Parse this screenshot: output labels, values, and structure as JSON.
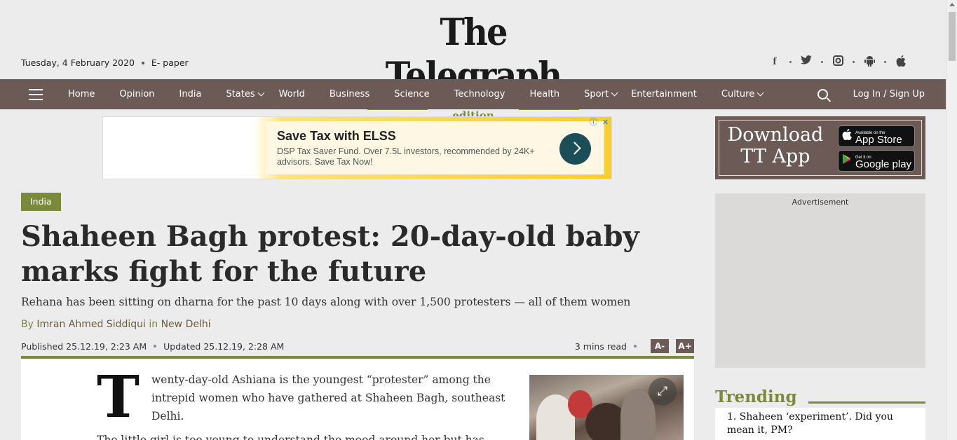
{
  "header": {
    "date": "Tuesday, 4 February 2020",
    "epaper": "E- paper",
    "logo_title": "The Telegraph",
    "logo_edition": "online edition",
    "social": [
      "facebook-icon",
      "twitter-icon",
      "instagram-icon",
      "android-icon",
      "apple-icon"
    ]
  },
  "nav": {
    "items": [
      {
        "label": "Home"
      },
      {
        "label": "Opinion"
      },
      {
        "label": "India"
      },
      {
        "label": "States",
        "dropdown": true
      },
      {
        "label": "World"
      },
      {
        "label": "Business"
      },
      {
        "label": "Science"
      },
      {
        "label": "Technology"
      },
      {
        "label": "Health"
      },
      {
        "label": "Sport",
        "dropdown": true
      },
      {
        "label": "Entertainment"
      },
      {
        "label": "Culture",
        "dropdown": true
      }
    ],
    "login": "Log In / Sign Up"
  },
  "ad": {
    "heading": "Save Tax with ELSS",
    "desc": "DSP Tax Saver Fund. Over 7.5L investors, recommended by 24K+ advisors. Save Tax Now!"
  },
  "sidebar": {
    "app_title_1": "Download",
    "app_title_2": "TT App",
    "appstore_small": "Available on the",
    "appstore_big": "App Store",
    "googleplay_small": "Get it on",
    "googleplay_big": "Google play",
    "ad_label": "Advertisement",
    "trending_title": "Trending",
    "trending_items": [
      "1. Shaheen ‘experiment’. Did you mean it, PM?"
    ]
  },
  "article": {
    "tag": "India",
    "headline": "Shaheen Bagh protest: 20-day-old baby marks fight for the future",
    "subhead": "Rehana has been sitting on dharna for the past 10 days along with over 1,500 protesters — all of them women",
    "by": "By",
    "author": "Imran Ahmed Siddiqui",
    "in": "in",
    "location": "New Delhi",
    "published": "Published 25.12.19, 2:23 AM",
    "updated": "Updated 25.12.19, 2:28 AM",
    "read_time": "3 mins read",
    "font_down": "A-",
    "font_up": "A+",
    "dropcap": "T",
    "para1": "wenty-day-old Ashiana is the youngest “protester” among the intrepid women who have gathered at Shaheen Bagh, southeast Delhi.",
    "para2": "The little girl is too young to understand the mood around her but has"
  },
  "colors": {
    "accent": "#7b8a3a",
    "nav_bg": "#6b5a55",
    "ad_button": "#1c4e57"
  }
}
